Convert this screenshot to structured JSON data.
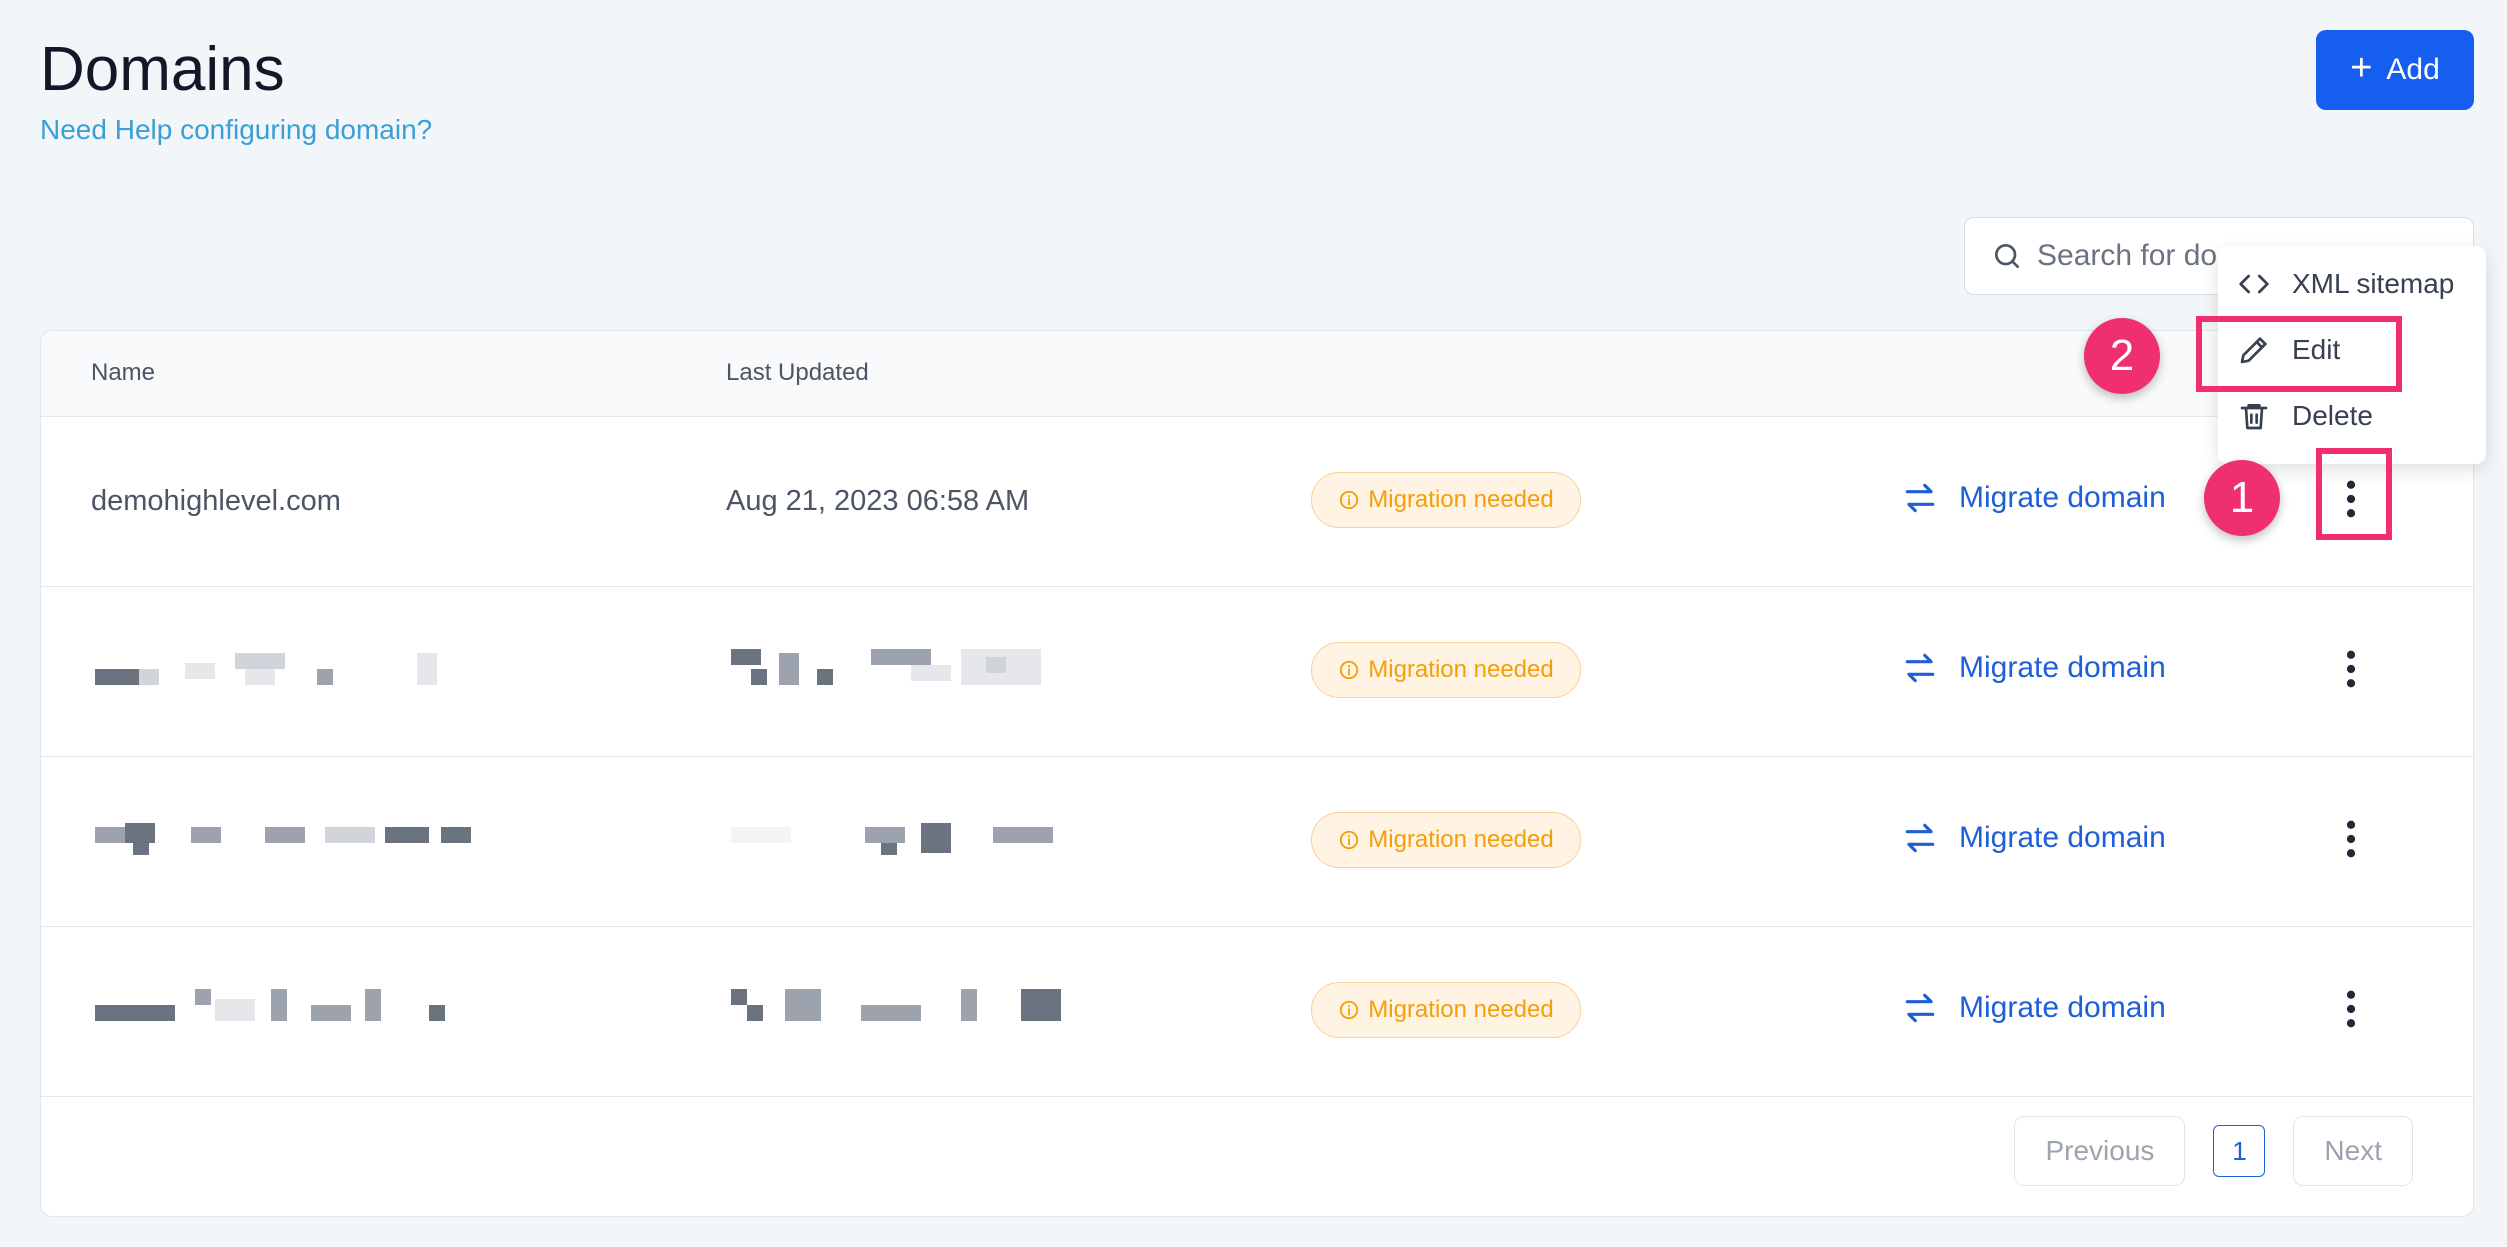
{
  "page": {
    "title": "Domains",
    "help_link": "Need Help configuring domain?",
    "add_label": "Add"
  },
  "search": {
    "placeholder": "Search for do"
  },
  "table": {
    "columns": [
      "Name",
      "Last Updated"
    ],
    "rows": [
      {
        "name": "demohighlevel.com",
        "last_updated": "Aug 21, 2023 06:58 AM",
        "status": "Migration needed",
        "action": "Migrate domain"
      },
      {
        "name": "",
        "last_updated": "",
        "status": "Migration needed",
        "action": "Migrate domain"
      },
      {
        "name": "",
        "last_updated": "",
        "status": "Migration needed",
        "action": "Migrate domain"
      },
      {
        "name": "",
        "last_updated": "",
        "status": "Migration needed",
        "action": "Migrate domain"
      }
    ]
  },
  "pagination": {
    "previous": "Previous",
    "page": "1",
    "next": "Next"
  },
  "menu": {
    "items": [
      "XML sitemap",
      "Edit",
      "Delete"
    ]
  },
  "annotations": {
    "step1": "1",
    "step2": "2"
  },
  "colors": {
    "accent": "#155eef",
    "link": "#1d5fd8",
    "warning": "#f59e0b",
    "highlight": "#f0306e"
  }
}
